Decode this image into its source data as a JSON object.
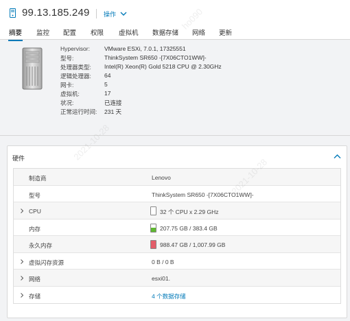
{
  "header": {
    "host_name": "99.13.185.249",
    "actions_label": "操作"
  },
  "tabs": [
    "摘要",
    "监控",
    "配置",
    "权限",
    "虚拟机",
    "数据存储",
    "网络",
    "更新"
  ],
  "active_tab": "摘要",
  "summary": [
    {
      "key": "Hypervisor:",
      "value": "VMware ESXi, 7.0.1, 17325551"
    },
    {
      "key": "型号:",
      "value": "ThinkSystem SR650 -[7X06CTO1WW]-"
    },
    {
      "key": "处理器类型:",
      "value": "Intel(R) Xeon(R) Gold 5218 CPU @ 2.30GHz"
    },
    {
      "key": "逻辑处理器:",
      "value": "64"
    },
    {
      "key": "网卡:",
      "value": "5"
    },
    {
      "key": "虚拟机:",
      "value": "17"
    },
    {
      "key": "状况:",
      "value": "已连接"
    },
    {
      "key": "正常运行时间:",
      "value": "231 天"
    }
  ],
  "hardware": {
    "title": "硬件",
    "rows": [
      {
        "label": "制造商",
        "value": "Lenovo",
        "expandable": false
      },
      {
        "label": "型号",
        "value": "ThinkSystem SR650 -[7X06CTO1WW]-",
        "expandable": false
      },
      {
        "label": "CPU",
        "value": "32 个 CPU x 2.29 GHz",
        "expandable": true,
        "usage": 0.0,
        "usage_color": "#c8c8c8"
      },
      {
        "label": "内存",
        "value": "207.75 GB / 383.4 GB",
        "expandable": false,
        "usage": 0.54,
        "usage_color": "#5fb832"
      },
      {
        "label": "永久内存",
        "value": "988.47 GB / 1,007.99 GB",
        "expandable": false,
        "usage": 0.98,
        "usage_color": "#e35d6a"
      },
      {
        "label": "虚拟闪存资源",
        "value": "0 B / 0 B",
        "expandable": true
      },
      {
        "label": "网络",
        "value": "esxi01.",
        "expandable": true
      },
      {
        "label": "存储",
        "value": "4 个数据存储",
        "expandable": true,
        "link": true
      }
    ]
  },
  "watermarks": [
    "h0",
    "ho090",
    "2021-10-28",
    "2021-10-28"
  ],
  "colors": {
    "accent": "#0079b8",
    "cpu_usage": "#c8c8c8",
    "memory_usage": "#5fb832",
    "pmem_usage": "#e35d6a"
  }
}
